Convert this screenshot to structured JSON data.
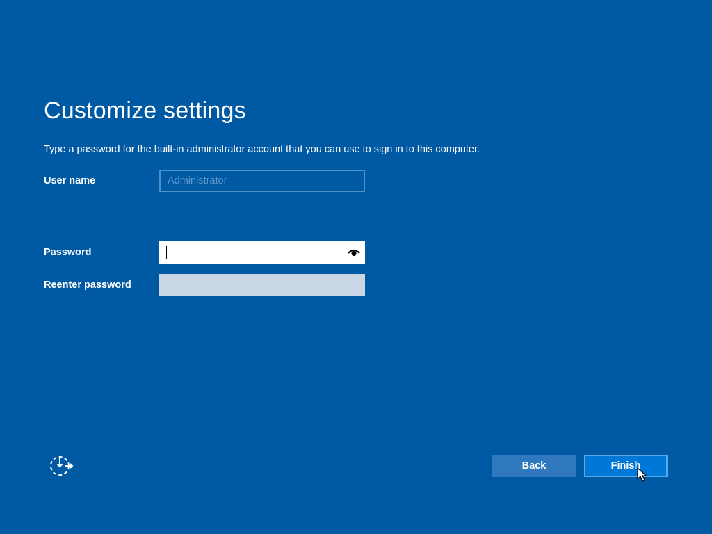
{
  "page": {
    "title": "Customize settings",
    "instruction": "Type a password for the built-in administrator account that you can use to sign in to this computer."
  },
  "form": {
    "username": {
      "label": "User name",
      "placeholder": "Administrator",
      "value": ""
    },
    "password": {
      "label": "Password",
      "value": "",
      "reveal_icon": "eye-icon"
    },
    "reenter": {
      "label": "Reenter password",
      "value": ""
    }
  },
  "footer": {
    "accessibility_icon": "ease-of-access-icon",
    "back_label": "Back",
    "finish_label": "Finish"
  },
  "colors": {
    "background": "#0059A3",
    "finish_button": "#0078D7",
    "back_button": "#2F78BD",
    "reenter_field": "#C9D6E3"
  }
}
